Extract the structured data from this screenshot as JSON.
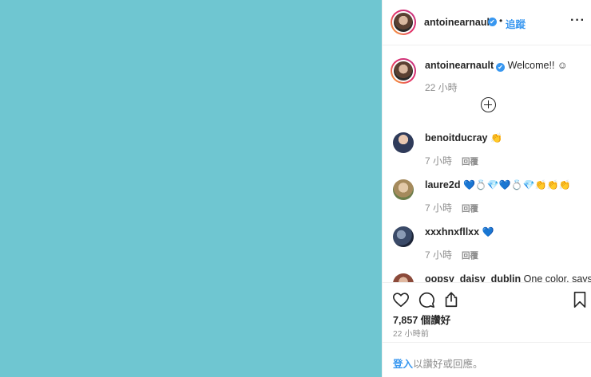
{
  "post": {
    "image_color": "#6fc6d1"
  },
  "header": {
    "username": "antoinearnault",
    "verified_glyph": "✔",
    "dot": "•",
    "follow_label": "追蹤",
    "more_glyph": "···"
  },
  "caption": {
    "username": "antoinearnault",
    "text": "Welcome!! ☺",
    "time": "22 小時"
  },
  "comments": [
    {
      "username": "benoitducray",
      "text": "👏",
      "time": "7 小時",
      "reply": "回覆"
    },
    {
      "username": "laure2d",
      "text": "💙💍💎💙💍💎👏👏👏",
      "time": "7 小時",
      "reply": "回覆"
    },
    {
      "username": "xxxhnxfllxx",
      "text": "💙",
      "time": "7 小時",
      "reply": "回覆"
    },
    {
      "username": "oopsy_daisy_dublin",
      "text": "One color, says"
    }
  ],
  "actions": {
    "likes": "7,857 個讚好",
    "posted": "22 小時前"
  },
  "login": {
    "link": "登入",
    "rest": "以讚好或回應。"
  },
  "colors": {
    "accent": "#3897f0",
    "muted": "#8e8e8e",
    "text": "#262626"
  },
  "icons": [
    "heart-icon",
    "comment-icon",
    "share-icon",
    "bookmark-icon",
    "plus-circle-icon",
    "verified-icon",
    "more-icon"
  ]
}
